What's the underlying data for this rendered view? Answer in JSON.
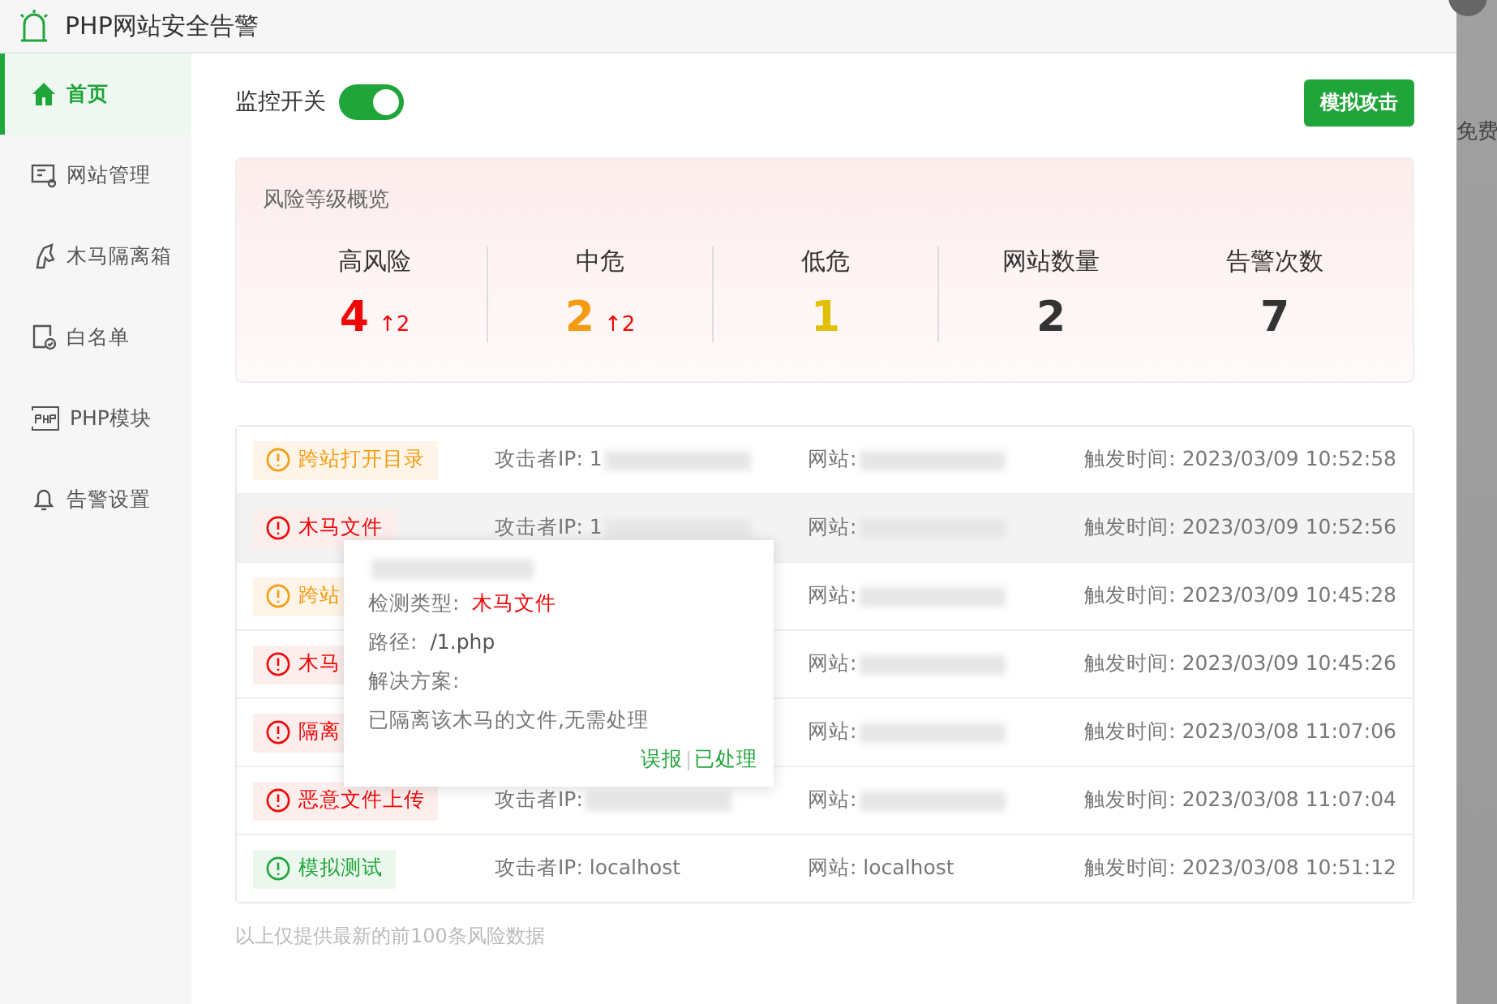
{
  "window": {
    "title": "PHP网站安全告警"
  },
  "sidebar": {
    "items": [
      {
        "label": "首页",
        "selected": true
      },
      {
        "label": "网站管理",
        "selected": false
      },
      {
        "label": "木马隔离箱",
        "selected": false
      },
      {
        "label": "白名单",
        "selected": false
      },
      {
        "label": "PHP模块",
        "selected": false
      },
      {
        "label": "告警设置",
        "selected": false
      }
    ]
  },
  "monitor": {
    "label": "监控开关",
    "on": true
  },
  "simulate_button": "模拟攻击",
  "overview": {
    "title": "风险等级概览",
    "stats": [
      {
        "label": "高风险",
        "value": "4",
        "change": "↑2",
        "kind": "high"
      },
      {
        "label": "中危",
        "value": "2",
        "change": "↑2",
        "kind": "medium"
      },
      {
        "label": "低危",
        "value": "1",
        "kind": "low"
      },
      {
        "label": "网站数量",
        "value": "2",
        "kind": "plain"
      },
      {
        "label": "告警次数",
        "value": "7",
        "kind": "plain"
      }
    ]
  },
  "alerts": [
    {
      "tag": "跨站打开目录",
      "kind": "medium",
      "ip": "攻击者IP: 1",
      "ip_redacted": true,
      "site": "网站:",
      "site_redacted": true,
      "time": "触发时间: 2023/03/09 10:52:58",
      "selected": false
    },
    {
      "tag": "木马文件",
      "kind": "high",
      "ip": "攻击者IP: 1",
      "ip_redacted": true,
      "site": "网站:",
      "site_redacted": true,
      "time": "触发时间: 2023/03/09 10:52:56",
      "selected": true
    },
    {
      "tag": "跨站",
      "kind": "medium",
      "site": "网站:",
      "site_redacted": true,
      "time": "触发时间: 2023/03/09 10:45:28",
      "selected": false
    },
    {
      "tag": "木马",
      "kind": "high",
      "site": "网站:",
      "site_redacted": true,
      "time": "触发时间: 2023/03/09 10:45:26",
      "selected": false
    },
    {
      "tag": "隔离",
      "kind": "high",
      "site": "网站:",
      "site_redacted": true,
      "time": "触发时间: 2023/03/08 11:07:06",
      "selected": false
    },
    {
      "tag": "恶意文件上传",
      "kind": "high",
      "ip": "攻击者IP:",
      "ip_redacted": true,
      "site": "网站:",
      "site_redacted": true,
      "time": "触发时间: 2023/03/08 11:07:04",
      "selected": false
    },
    {
      "tag": "模拟测试",
      "kind": "test",
      "ip": "攻击者IP: localhost",
      "ip_redacted": false,
      "site": "网站: localhost",
      "site_redacted": false,
      "time": "触发时间: 2023/03/08 10:51:12",
      "selected": false
    }
  ],
  "popup": {
    "header_redacted": true,
    "type_label": "检测类型:",
    "type_value": "木马文件",
    "path_label": "路径:",
    "path_value": "/1.php",
    "solution_label": "解决方案:",
    "solution_text": "已隔离该木马的文件,无需处理",
    "actions": [
      "误报",
      "已处理"
    ]
  },
  "footnote": "以上仅提供最新的前100条风险数据",
  "backdrop_text": "免费"
}
